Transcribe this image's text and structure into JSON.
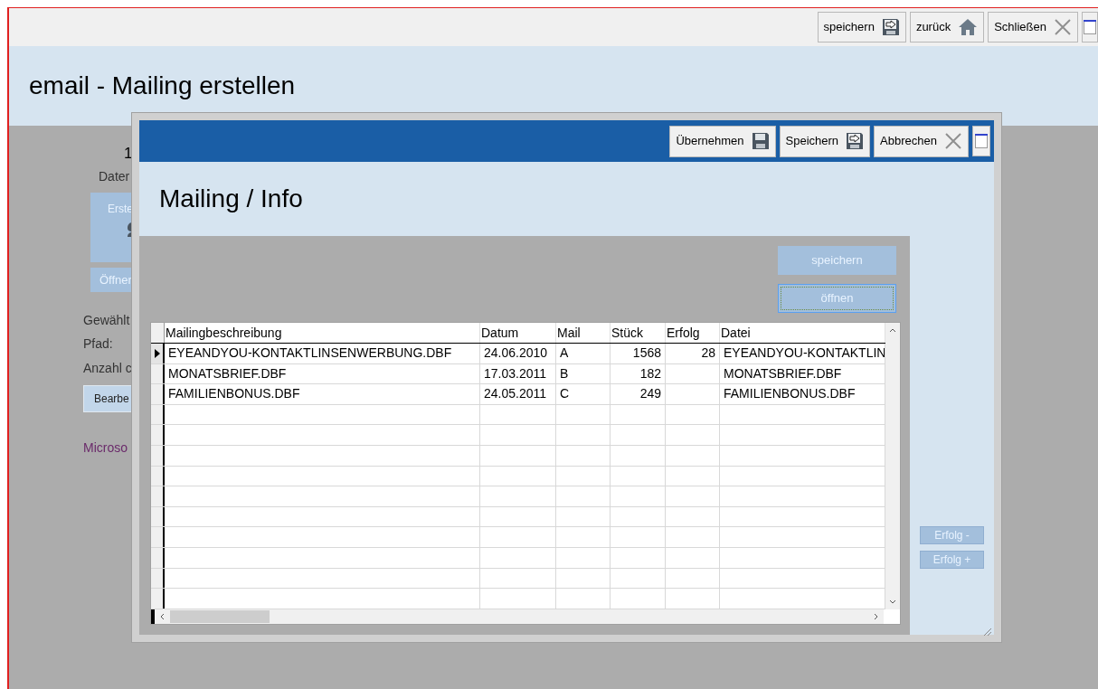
{
  "window": {
    "title": "email - Mailing erstellen",
    "toolbar": [
      {
        "label": "speichern",
        "kind": "export"
      },
      {
        "label": "zurück",
        "kind": "home"
      },
      {
        "label": "Schließen",
        "kind": "close"
      }
    ]
  },
  "background_form": {
    "number": "1",
    "label_top": "Dater",
    "create_button": "Erste",
    "open_button": "Öffner",
    "fields": [
      "Gewählt",
      "Pfad:",
      "Anzahl c"
    ],
    "edit_button": "Bearbe",
    "link": "Microso"
  },
  "dialog": {
    "title": "Mailing / Info",
    "toolbar": [
      {
        "label": "Übernehmen",
        "kind": "save"
      },
      {
        "label": "Speichern",
        "kind": "export"
      },
      {
        "label": "Abbrechen",
        "kind": "close"
      }
    ],
    "buttons": [
      {
        "label": "speichern",
        "focused": false
      },
      {
        "label": "öffnen",
        "focused": true
      }
    ],
    "table": {
      "columns": [
        "Mailingbeschreibung",
        "Datum",
        "Mail",
        "Stück",
        "Erfolg",
        "Datei"
      ],
      "rows": [
        {
          "selected": true,
          "cells": [
            "EYEANDYOU-KONTAKTLINSENWERBUNG.DBF",
            "24.06.2010",
            "A",
            "1568",
            "28",
            "EYEANDYOU-KONTAKTLIN"
          ]
        },
        {
          "selected": false,
          "cells": [
            "MONATSBRIEF.DBF",
            "17.03.2011",
            "B",
            "182",
            "",
            "MONATSBRIEF.DBF"
          ]
        },
        {
          "selected": false,
          "cells": [
            "FAMILIENBONUS.DBF",
            "24.05.2011",
            "C",
            "249",
            "",
            "FAMILIENBONUS.DBF"
          ]
        }
      ]
    },
    "side_buttons": [
      "Erfolg -",
      "Erfolg +"
    ]
  }
}
